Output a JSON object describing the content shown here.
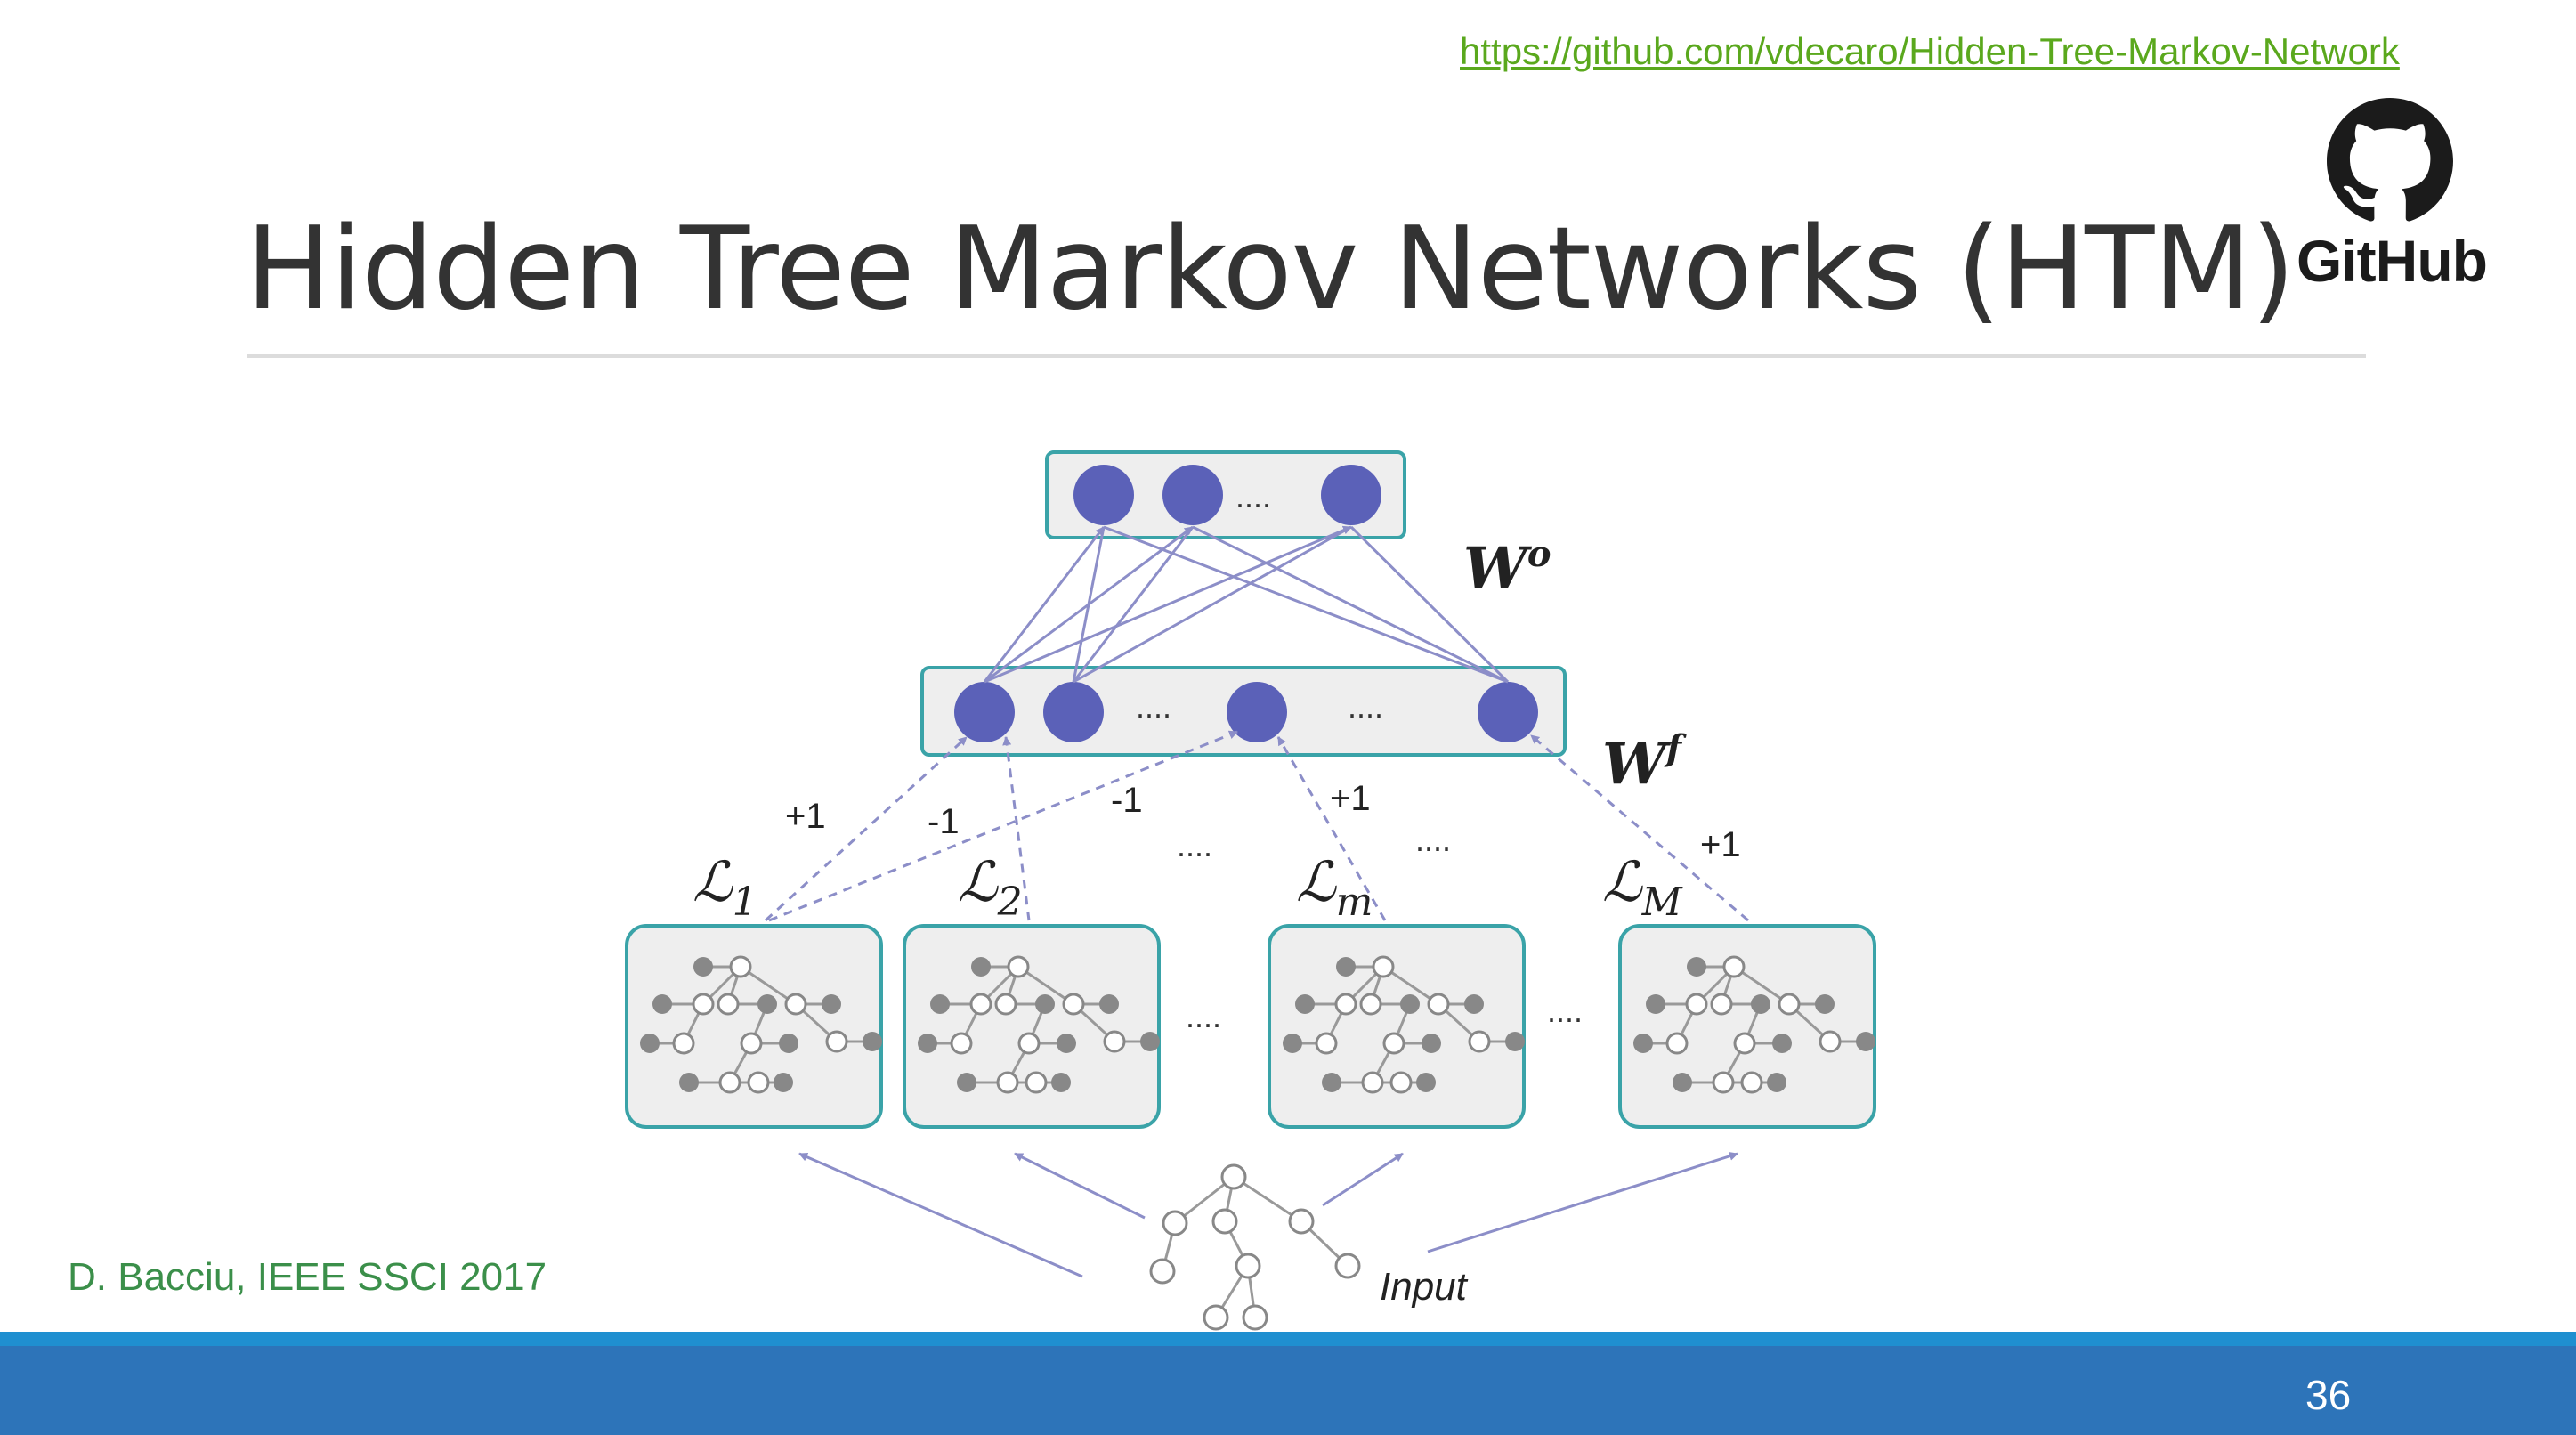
{
  "slide": {
    "url": "https://github.com/vdecaro/Hidden-Tree-Markov-Network",
    "logo_text": "GitHub",
    "title": "Hidden Tree Markov Networks (HTM)",
    "citation": "D. Bacciu, IEEE SSCI 2017",
    "page_number": "36"
  },
  "colors": {
    "node_fill": "#5b61b8",
    "layer_border": "#3aa3a8",
    "layer_fill": "#eeeeee",
    "arrow": "#8c8ec8",
    "footer": "#2d74b9",
    "link": "#5aa81d",
    "citation": "#3b8f4a"
  },
  "diagram": {
    "output_ellipsis": "....",
    "hidden_ellipsis": "....",
    "weight_output": "W",
    "weight_output_sup": "o",
    "weight_hidden": "W",
    "weight_hidden_sup": "f",
    "edge_labels": [
      "+1",
      "-1",
      "-1",
      "+1",
      "+1"
    ],
    "between_dots": "....",
    "models": [
      {
        "symbol": "ℒ",
        "subscript": "1"
      },
      {
        "symbol": "ℒ",
        "subscript": "2"
      },
      {
        "symbol": "ℒ",
        "subscript": "m"
      },
      {
        "symbol": "ℒ",
        "subscript": "M"
      }
    ],
    "input_label": "Input"
  }
}
